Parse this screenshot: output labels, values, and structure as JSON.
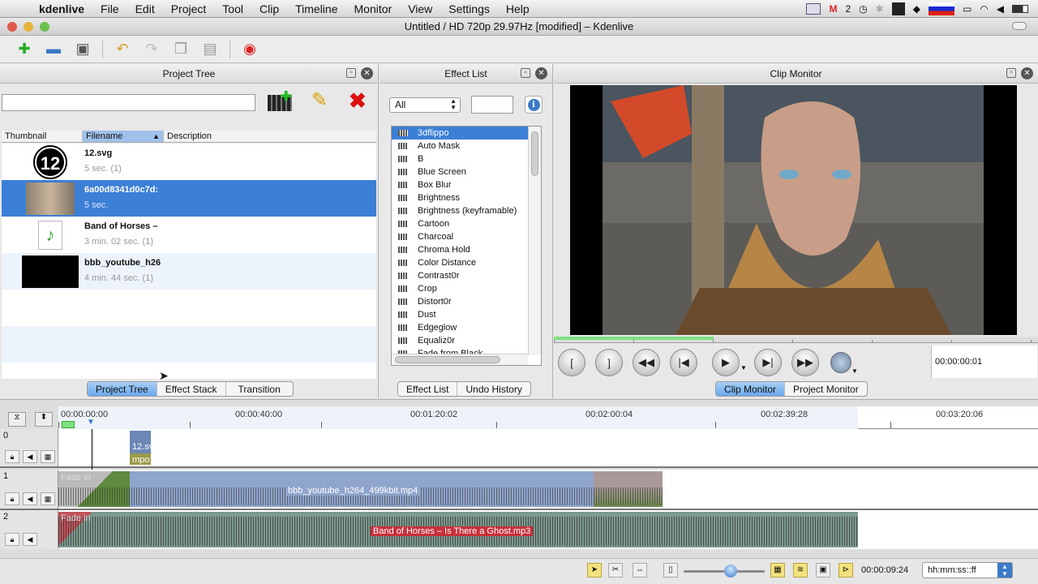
{
  "menubar": {
    "app": "kdenlive",
    "menus": [
      "File",
      "Edit",
      "Project",
      "Tool",
      "Clip",
      "Timeline",
      "Monitor",
      "View",
      "Settings",
      "Help"
    ],
    "gmail_count": "2"
  },
  "window": {
    "title": "Untitled / HD 720p 29.97Hz [modified] – Kdenlive"
  },
  "project_tree": {
    "title": "Project Tree",
    "columns": [
      "Thumbnail",
      "Filename",
      "Description"
    ],
    "items": [
      {
        "name": "12.svg",
        "duration": "5 sec. (1)",
        "thumb_text": "12"
      },
      {
        "name": "6a00d8341d0c7d:",
        "duration": "5 sec.",
        "thumb_text": ""
      },
      {
        "name": "Band of Horses –",
        "duration": "3 min. 02 sec. (1)",
        "thumb_text": "♪"
      },
      {
        "name": "bbb_youtube_h26",
        "duration": "4 min. 44 sec. (1)",
        "thumb_text": ""
      }
    ],
    "tabs": [
      "Project Tree",
      "Effect Stack",
      "Transition"
    ]
  },
  "effect_list": {
    "title": "Effect List",
    "filter": "All",
    "items": [
      "3dflippo",
      "Auto Mask",
      "B",
      "Blue Screen",
      "Box Blur",
      "Brightness",
      "Brightness (keyframable)",
      "Cartoon",
      "Charcoal",
      "Chroma Hold",
      "Color Distance",
      "Contrast0r",
      "Crop",
      "Distort0r",
      "Dust",
      "Edgeglow",
      "Equaliz0r",
      "Fade from Black"
    ],
    "tabs": [
      "Effect List",
      "Undo History"
    ]
  },
  "clip_monitor": {
    "title": "Clip Monitor",
    "timecode": "00:00:00:01",
    "progress": 0.33,
    "tabs": [
      "Clip Monitor",
      "Project Monitor"
    ]
  },
  "timeline": {
    "ruler": [
      "00:00:00:00",
      "00:00:40:00",
      "00:01:20:02",
      "00:02:00:04",
      "00:02:39:28",
      "00:03:20:06"
    ],
    "tracks": [
      {
        "num": "0",
        "clips": [
          {
            "label": "12.sv"
          },
          {
            "label": "mpo:"
          }
        ]
      },
      {
        "num": "1",
        "fade": "Fade in",
        "clip": "bbb_youtube_h264_499kbit.mp4"
      },
      {
        "num": "2",
        "fade": "Fade in",
        "clip": "Band of Horses – Is There a Ghost.mp3"
      }
    ]
  },
  "status": {
    "time": "00:00:09:24",
    "format": "hh:mm:ss::ff",
    "zoom": 0.58
  }
}
